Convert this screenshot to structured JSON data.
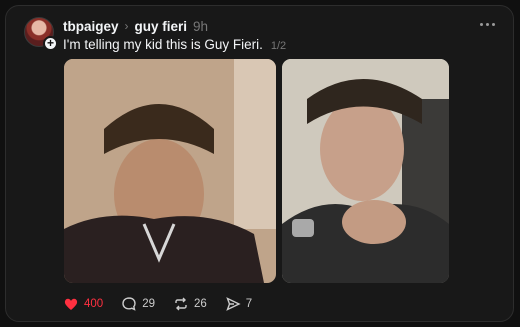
{
  "post": {
    "username": "tbpaigey",
    "community": "guy fieri",
    "time": "9h",
    "text": "I'm telling my kid this is Guy Fieri.",
    "image_counter": "1/2"
  },
  "actions": {
    "likes": "400",
    "replies": "29",
    "reposts": "26",
    "shares": "7"
  },
  "colors": {
    "like": "#ff3040",
    "background": "#101010",
    "card": "#181818"
  },
  "icons": [
    "avatar",
    "plus-icon",
    "chevron-right-icon",
    "more-icon",
    "heart-icon",
    "comment-icon",
    "repost-icon",
    "share-icon"
  ]
}
